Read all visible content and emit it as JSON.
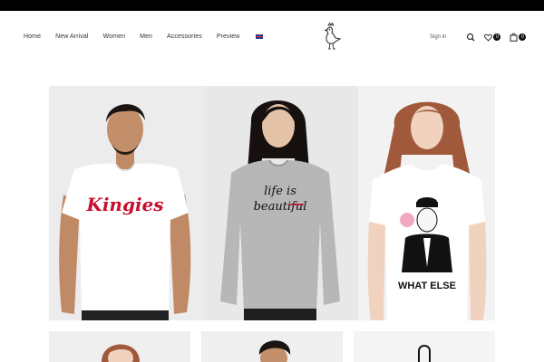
{
  "nav": {
    "items": [
      {
        "label": "Home"
      },
      {
        "label": "New Arrival"
      },
      {
        "label": "Women"
      },
      {
        "label": "Men"
      },
      {
        "label": "Accessories"
      },
      {
        "label": "Preview"
      }
    ],
    "language_icon": "uk-flag-icon"
  },
  "header": {
    "logo_icon": "bird-logo-icon",
    "signin_label": "Sign in",
    "search_icon": "search-icon",
    "wishlist_icon": "heart-icon",
    "wishlist_count": "0",
    "cart_icon": "shopping-bag-icon",
    "cart_count": "0"
  },
  "products": [
    {
      "print_text": "Kingies",
      "print_color": "#c8102e"
    },
    {
      "print_text_line1": "life is",
      "print_text_line2": "beautiful"
    },
    {
      "print_text": "WHAT ELSE"
    }
  ],
  "colors": {
    "topbar": "#000000",
    "badge": "#111111"
  }
}
